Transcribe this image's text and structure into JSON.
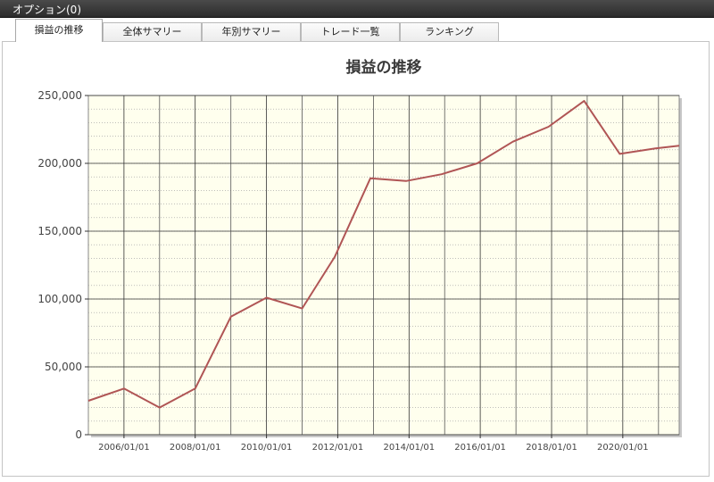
{
  "window": {
    "title": "オプション(0)"
  },
  "tabs": [
    {
      "label": "損益の推移",
      "active": true
    },
    {
      "label": "全体サマリー",
      "active": false
    },
    {
      "label": "年別サマリー",
      "active": false
    },
    {
      "label": "トレード一覧",
      "active": false
    },
    {
      "label": "ランキング",
      "active": false
    }
  ],
  "chart_data": {
    "type": "line",
    "title": "損益の推移",
    "xlabel": "",
    "ylabel": "",
    "ylim": [
      0,
      250000
    ],
    "yticks": [
      0,
      50000,
      100000,
      150000,
      200000,
      250000
    ],
    "ytick_labels": [
      "0",
      "50,000",
      "100,000",
      "150,000",
      "200,000",
      "250,000"
    ],
    "xlim": [
      "2005/01/01",
      "2021/08/01"
    ],
    "xtick_labels": [
      "2006/01/01",
      "2008/01/01",
      "2010/01/01",
      "2012/01/01",
      "2014/01/01",
      "2016/01/01",
      "2018/01/01",
      "2020/01/01"
    ],
    "grid": true,
    "line_color": "#b05555",
    "plot_background": "#ffffee",
    "series": [
      {
        "x": [
          "2005/01/01",
          "2006/01/01",
          "2007/01/01",
          "2008/01/01",
          "2009/01/01",
          "2010/01/01",
          "2011/01/01",
          "2011/12/01",
          "2012/12/01",
          "2013/12/01",
          "2014/12/01",
          "2015/12/01",
          "2016/12/01",
          "2017/12/01",
          "2018/12/01",
          "2019/12/01",
          "2020/12/01",
          "2021/08/01"
        ],
        "values": [
          25000,
          34000,
          20000,
          34000,
          87000,
          101000,
          93000,
          131000,
          189000,
          187000,
          192000,
          200000,
          216000,
          227000,
          246000,
          207000,
          211000,
          213000
        ]
      }
    ]
  }
}
